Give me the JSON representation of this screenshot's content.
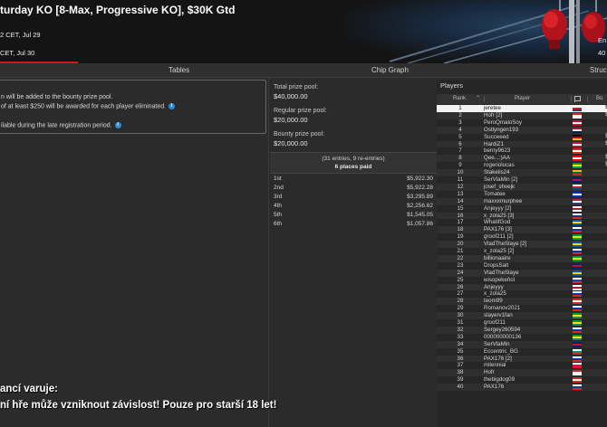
{
  "header": {
    "title": "turday KO [8-Max, Progressive KO], $30K Gtd",
    "date_line1": "2 CET, Jul 29",
    "date_line2": "CET, Jul 30",
    "right_label1": "En",
    "right_label2": "40"
  },
  "tabs": [
    {
      "label": "Tables"
    },
    {
      "label": "Chip Graph"
    },
    {
      "label": "Struc"
    }
  ],
  "info": {
    "line1": "n will be added to the bounty prize pool.",
    "line2": "of at least $250 will be awarded for each player eliminated.",
    "line3": "ilable during the late registration period."
  },
  "prize": {
    "total_label": "Total prize pool:",
    "total_value": "$40,000.00",
    "regular_label": "Regular prize pool:",
    "regular_value": "$20,000.00",
    "bounty_label": "Bounty prize pool:",
    "bounty_value": "$20,000.00",
    "entries": "(31 entries, 9 re-entries)",
    "places_paid": "6 places paid"
  },
  "payouts": [
    {
      "place": "1st",
      "amount": "$5,922.30"
    },
    {
      "place": "2nd",
      "amount": "$5,922.28"
    },
    {
      "place": "3rd",
      "amount": "$3,295.89"
    },
    {
      "place": "4th",
      "amount": "$2,256.62"
    },
    {
      "place": "5th",
      "amount": "$1,545.05"
    },
    {
      "place": "6th",
      "amount": "$1,057.86"
    }
  ],
  "players_panel": {
    "title": "Players",
    "col_rank": "Rank",
    "col_player": "Player",
    "col_bounty": "Bo"
  },
  "players": [
    {
      "rank": "1",
      "name": "jeretee",
      "flag": [
        "#ffffff",
        "#d7141a",
        "#11457e"
      ]
    },
    {
      "rank": "2",
      "name": "Hofr [2]",
      "flag": [
        "#d52b1e",
        "#ffffff",
        "#ffffff"
      ]
    },
    {
      "rank": "3",
      "name": "PeroQmaloSoy",
      "flag": [
        "#c8102e",
        "#ffffff",
        "#c8102e"
      ]
    },
    {
      "rank": "4",
      "name": "Ostlyngen193",
      "flag": [
        "#ba0c2f",
        "#ffffff",
        "#00205b"
      ]
    },
    {
      "rank": "5",
      "name": "Succeeed",
      "flag": [
        "#000000",
        "#dd0000",
        "#ffce00"
      ]
    },
    {
      "rank": "6",
      "name": "HardiZ1",
      "flag": [
        "#c8102e",
        "#ffffff",
        "#c8102e"
      ]
    },
    {
      "rank": "7",
      "name": "berny9623",
      "flag": [
        "#d52b1e",
        "#ffffff",
        "#d52b1e"
      ]
    },
    {
      "rank": "8",
      "name": "Qee...:)AA",
      "flag": [
        "#ff0000",
        "#ffffff",
        "#ff0000"
      ]
    },
    {
      "rank": "9",
      "name": "rogeriolucas",
      "flag": [
        "#009c3b",
        "#ffdf00",
        "#009c3b"
      ]
    },
    {
      "rank": "10",
      "name": "Stakelis24",
      "flag": [
        "#fdb913",
        "#006a44",
        "#c1272d"
      ]
    },
    {
      "rank": "11",
      "name": "SerVlaMin [2]",
      "flag": [
        "#012169",
        "#c8102e",
        "#012169"
      ]
    },
    {
      "rank": "12",
      "name": "josef_shvejk",
      "flag": [
        "#ffffff",
        "#d7141a",
        "#11457e"
      ]
    },
    {
      "rank": "13",
      "name": "Tomatee",
      "flag": [
        "#0038a8",
        "#ffffff",
        "#0038a8"
      ]
    },
    {
      "rank": "14",
      "name": "maxxxmurphee",
      "flag": [
        "#b22234",
        "#ffffff",
        "#3c3b6e"
      ]
    },
    {
      "rank": "15",
      "name": "Anjeyyy [2]",
      "flag": [
        "#ffffff",
        "#c8102e",
        "#ffffff"
      ]
    },
    {
      "rank": "16",
      "name": "x_zola25 [3]",
      "flag": [
        "#ffffff",
        "#0039a6",
        "#d52b1e"
      ]
    },
    {
      "rank": "17",
      "name": "WhatifGod",
      "flag": [
        "#0057b7",
        "#ffd700",
        "#0057b7"
      ]
    },
    {
      "rank": "18",
      "name": "PAX176 [3]",
      "flag": [
        "#ffffff",
        "#0039a6",
        "#d52b1e"
      ]
    },
    {
      "rank": "19",
      "name": "groof211 [2]",
      "flag": [
        "#009c3b",
        "#ffdf00",
        "#009c3b"
      ]
    },
    {
      "rank": "20",
      "name": "VladTheSlaye [2]",
      "flag": [
        "#0057b7",
        "#ffd700",
        "#0057b7"
      ]
    },
    {
      "rank": "21",
      "name": "x_zola25 [2]",
      "flag": [
        "#ffffff",
        "#0039a6",
        "#d52b1e"
      ]
    },
    {
      "rank": "22",
      "name": "billionaaire",
      "flag": [
        "#009c3b",
        "#ffdf00",
        "#009c3b"
      ]
    },
    {
      "rank": "23",
      "name": "DropsSalt",
      "flag": [
        "#012169",
        "#c8102e",
        "#012169"
      ]
    },
    {
      "rank": "24",
      "name": "VladTheSlaye",
      "flag": [
        "#0057b7",
        "#ffd700",
        "#0057b7"
      ]
    },
    {
      "rank": "25",
      "name": "wisopekeňol",
      "flag": [
        "#ffffff",
        "#0b4ea2",
        "#ee1c25"
      ]
    },
    {
      "rank": "26",
      "name": "Anjeyyy",
      "flag": [
        "#ffffff",
        "#c8102e",
        "#ffffff"
      ]
    },
    {
      "rank": "27",
      "name": "x_zola25",
      "flag": [
        "#ffffff",
        "#0039a6",
        "#d52b1e"
      ]
    },
    {
      "rank": "28",
      "name": "teom99",
      "flag": [
        "#d52b1e",
        "#ffffff",
        "#d52b1e"
      ]
    },
    {
      "rank": "29",
      "name": "Romanov2021",
      "flag": [
        "#ffffff",
        "#0039a6",
        "#d52b1e"
      ]
    },
    {
      "rank": "30",
      "name": "slayerv1fan",
      "flag": [
        "#009c3b",
        "#ffdf00",
        "#009c3b"
      ]
    },
    {
      "rank": "31",
      "name": "groof211",
      "flag": [
        "#009c3b",
        "#ffdf00",
        "#009c3b"
      ]
    },
    {
      "rank": "32",
      "name": "Sergey260594",
      "flag": [
        "#ffffff",
        "#0039a6",
        "#d52b1e"
      ]
    },
    {
      "rank": "33",
      "name": "000000000136",
      "flag": [
        "#009c3b",
        "#ffdf00",
        "#009c3b"
      ]
    },
    {
      "rank": "34",
      "name": "SerVlaMin",
      "flag": [
        "#012169",
        "#c8102e",
        "#012169"
      ]
    },
    {
      "rank": "35",
      "name": "Eccentric_BG",
      "flag": [
        "#ffffff",
        "#00966e",
        "#d62612"
      ]
    },
    {
      "rank": "36",
      "name": "PAX176 [2]",
      "flag": [
        "#ffffff",
        "#0039a6",
        "#d52b1e"
      ]
    },
    {
      "rank": "37",
      "name": "milennial",
      "flag": [
        "#ffffff",
        "#dc143c",
        "#dc143c"
      ]
    },
    {
      "rank": "38",
      "name": "Hofr",
      "flag": [
        "#d52b1e",
        "#ffffff",
        "#ffffff"
      ]
    },
    {
      "rank": "39",
      "name": "thebigdog09",
      "flag": [
        "#d52b1e",
        "#ffffff",
        "#d52b1e"
      ]
    },
    {
      "rank": "40",
      "name": "PAX176",
      "flag": [
        "#ffffff",
        "#0039a6",
        "#d52b1e"
      ]
    }
  ],
  "bounty_fragments": [
    {
      "row": 1,
      "text": "$"
    },
    {
      "row": 2,
      "text": "$"
    },
    {
      "row": 5,
      "text": "$"
    },
    {
      "row": 6,
      "text": "$"
    },
    {
      "row": 8,
      "text": "$"
    },
    {
      "row": 9,
      "text": "$"
    }
  ],
  "warning": {
    "line1": "ancí varuje:",
    "line2": "ní hře může vzniknout závislost! Pouze pro starší 18 let!"
  },
  "colors": {
    "accent": "#d0171f",
    "info_icon": "#2f8cd6",
    "highlight_row": "#f2f2f2"
  }
}
